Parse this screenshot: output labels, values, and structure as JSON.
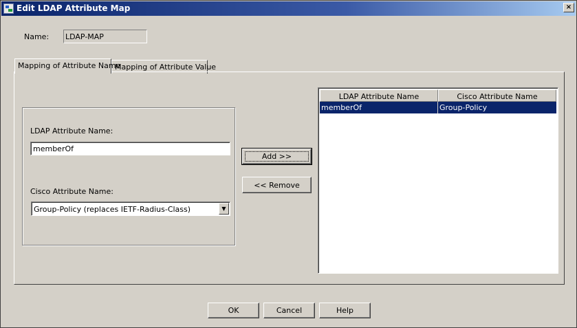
{
  "window": {
    "title": "Edit LDAP Attribute Map",
    "close_glyph": "×"
  },
  "name": {
    "label": "Name:",
    "value": "LDAP-MAP"
  },
  "tabs": [
    {
      "label": "Mapping of Attribute Name",
      "active": true
    },
    {
      "label": "Mapping of Attribute Value",
      "active": false
    }
  ],
  "form": {
    "ldap_label": "LDAP Attribute Name:",
    "ldap_value": "memberOf",
    "cisco_label": "Cisco Attribute Name:",
    "cisco_selected": "Group-Policy (replaces IETF-Radius-Class)"
  },
  "actions": {
    "add_label": "Add >>",
    "remove_label": "<< Remove"
  },
  "table": {
    "columns": [
      "LDAP Attribute Name",
      "Cisco Attribute Name"
    ],
    "rows": [
      [
        "memberOf",
        "Group-Policy"
      ]
    ]
  },
  "footer": {
    "ok_label": "OK",
    "cancel_label": "Cancel",
    "help_label": "Help"
  },
  "colors": {
    "titlebar": "#0a246a",
    "selection": "#0a246a",
    "face": "#d4d0c8"
  }
}
